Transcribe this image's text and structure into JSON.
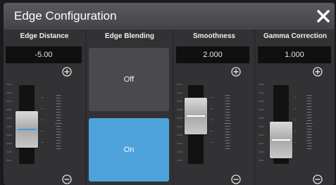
{
  "title": "Edge Configuration",
  "close_icon": "close-icon",
  "columns": {
    "edge_distance": {
      "label": "Edge Distance",
      "value": "-5.00",
      "level": 0.45,
      "indicator_color": "#3a9ee0"
    },
    "edge_blending": {
      "label": "Edge Blending",
      "off_label": "Off",
      "on_label": "On",
      "selected": "On"
    },
    "smoothness": {
      "label": "Smoothness",
      "value": "2.000",
      "level": 0.7,
      "indicator_color": "#ffffff"
    },
    "gamma_correction": {
      "label": "Gamma Correction",
      "value": "1.000",
      "level": 0.25,
      "indicator_color": "#ffffff"
    }
  },
  "colors": {
    "accent": "#4ea3dd",
    "title_bar": "#4e4e52",
    "panel": "#323235"
  }
}
